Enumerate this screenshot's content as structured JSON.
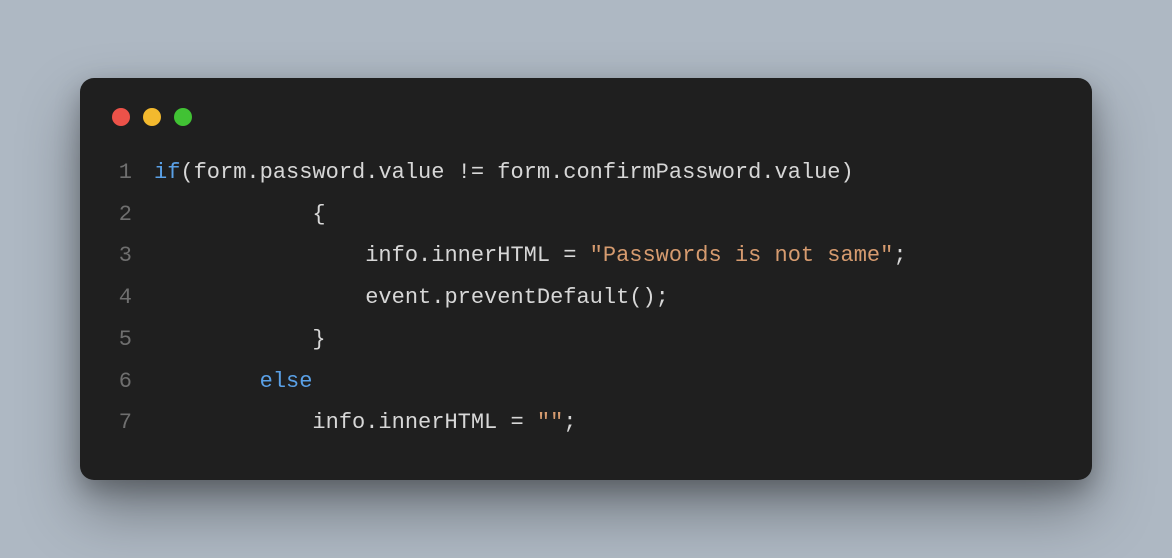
{
  "window": {
    "traffic_lights": {
      "red": "#ec5249",
      "yellow": "#f3b92e",
      "green": "#41c234"
    }
  },
  "code": {
    "lines": [
      {
        "n": "1",
        "tokens": [
          {
            "cls": "tok-key",
            "t": "if"
          },
          {
            "cls": "tok-punc",
            "t": "(form.password.value != form.confirmPassword.value)"
          }
        ]
      },
      {
        "n": "2",
        "tokens": [
          {
            "cls": "tok-punc",
            "t": "            {"
          }
        ]
      },
      {
        "n": "3",
        "tokens": [
          {
            "cls": "tok-id",
            "t": "                info.innerHTML = "
          },
          {
            "cls": "tok-str",
            "t": "\"Passwords is not same\""
          },
          {
            "cls": "tok-punc",
            "t": ";"
          }
        ]
      },
      {
        "n": "4",
        "tokens": [
          {
            "cls": "tok-id",
            "t": "                event.preventDefault();"
          }
        ]
      },
      {
        "n": "5",
        "tokens": [
          {
            "cls": "tok-punc",
            "t": "            }"
          }
        ]
      },
      {
        "n": "6",
        "tokens": [
          {
            "cls": "tok-id",
            "t": "        "
          },
          {
            "cls": "tok-key",
            "t": "else"
          }
        ]
      },
      {
        "n": "7",
        "tokens": [
          {
            "cls": "tok-id",
            "t": "            info.innerHTML = "
          },
          {
            "cls": "tok-str",
            "t": "\"\""
          },
          {
            "cls": "tok-punc",
            "t": ";"
          }
        ]
      }
    ]
  }
}
